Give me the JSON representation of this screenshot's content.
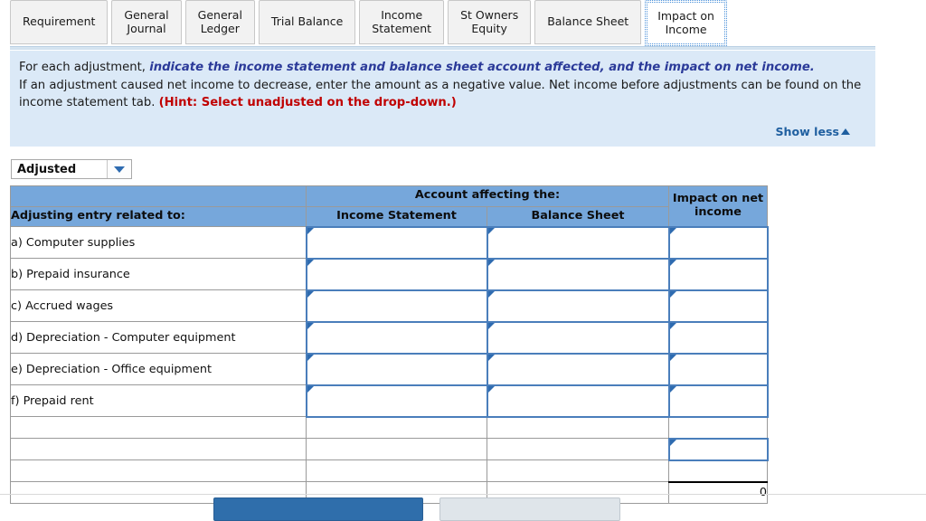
{
  "tabs": [
    {
      "label": "Requirement",
      "active": false
    },
    {
      "label": "General\nJournal",
      "active": false
    },
    {
      "label": "General\nLedger",
      "active": false
    },
    {
      "label": "Trial Balance",
      "active": false
    },
    {
      "label": "Income\nStatement",
      "active": false
    },
    {
      "label": "St Owners\nEquity",
      "active": false
    },
    {
      "label": "Balance Sheet",
      "active": false
    },
    {
      "label": "Impact on\nIncome",
      "active": true
    }
  ],
  "instructions": {
    "line1_a": "For each adjustment, ",
    "line1_b": "indicate the income statement and balance sheet account affected, and the impact on net income.",
    "line2": "If an adjustment caused net income to decrease, enter the amount as a negative value.  Net income before adjustments can be found on the income statement tab.  ",
    "hint": "(Hint:  Select unadjusted on the drop-down.)",
    "show_less_label": "Show less",
    "accent_blue": "#2b3a99",
    "hint_red": "#c00000",
    "panel_bg": "#dbe9f7"
  },
  "dropdown": {
    "selected": "Adjusted",
    "options": [
      "Adjusted",
      "Unadjusted"
    ]
  },
  "table": {
    "group_header": "Account affecting the:",
    "col_entry": "Adjusting entry related to:",
    "col_income_statement": "Income Statement",
    "col_balance_sheet": "Balance Sheet",
    "col_impact": "Impact on net\nincome",
    "header_bg": "#76a7db",
    "input_border": "#4a7ebb",
    "rows": [
      {
        "label": "a)  Computer supplies",
        "income_statement": "",
        "balance_sheet": "",
        "impact": ""
      },
      {
        "label": "b)  Prepaid insurance",
        "income_statement": "",
        "balance_sheet": "",
        "impact": ""
      },
      {
        "label": "c)  Accrued wages",
        "income_statement": "",
        "balance_sheet": "",
        "impact": ""
      },
      {
        "label": "d)  Depreciation - Computer equipment",
        "income_statement": "",
        "balance_sheet": "",
        "impact": ""
      },
      {
        "label": "e)  Depreciation - Office equipment",
        "income_statement": "",
        "balance_sheet": "",
        "impact": ""
      },
      {
        "label": "f)  Prepaid rent",
        "income_statement": "",
        "balance_sheet": "",
        "impact": ""
      }
    ],
    "footer_rows": [
      {
        "label": "",
        "impact": "",
        "style": "plain"
      },
      {
        "label": "",
        "impact": "",
        "style": "input"
      },
      {
        "label": "",
        "impact": "",
        "style": "plain-topblack"
      },
      {
        "label": "",
        "impact": "0",
        "style": "total"
      }
    ]
  },
  "buttons": {
    "primary": "",
    "secondary": ""
  }
}
